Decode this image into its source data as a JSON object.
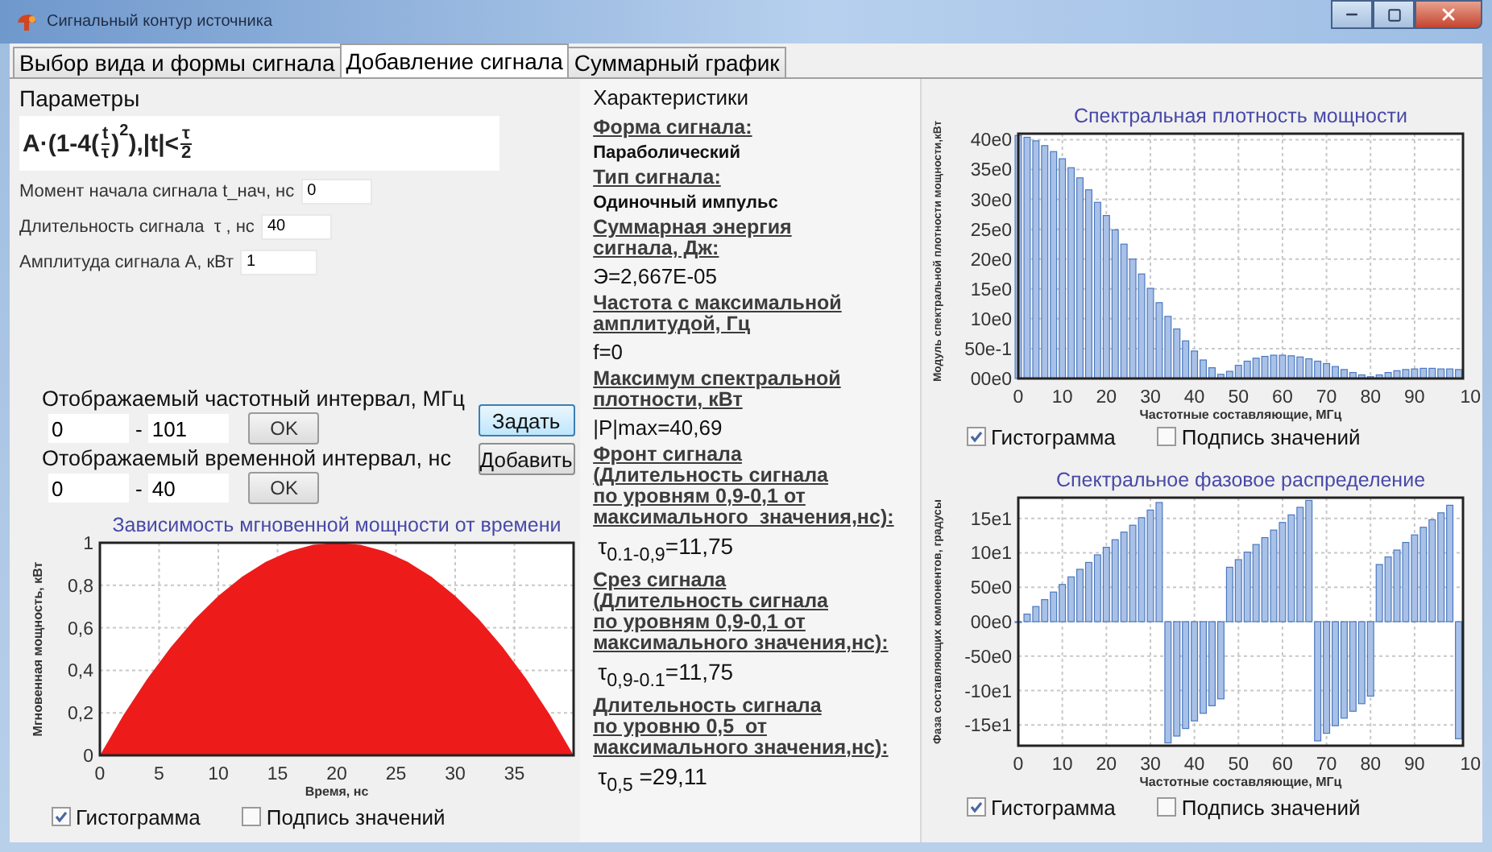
{
  "window": {
    "title": "Сигнальный контур источника"
  },
  "tabs": [
    {
      "label": "Выбор вида и формы сигнала",
      "selected": false
    },
    {
      "label": "Добавление сигнала",
      "selected": true
    },
    {
      "label": "Суммарный график",
      "selected": false
    }
  ],
  "parameters": {
    "heading": "Параметры",
    "formula": {
      "lead": "A·(1-4(",
      "frac_1": {
        "num": "t",
        "den": "τ"
      },
      "close": ")",
      "power": "2",
      "middle": "),|t|<",
      "frac_2": {
        "num": "τ",
        "den": "2"
      }
    },
    "fields": [
      {
        "label": "Момент начала сигнала t_нач, нс",
        "value": "0"
      },
      {
        "label": "Длительность сигнала  τ , нс",
        "value": "40"
      },
      {
        "label": "Амплитуда сигнала А, кВт",
        "value": "1"
      }
    ]
  },
  "intervals": [
    {
      "label": "Отображаемый частотный интервал, МГц",
      "from": "0",
      "separator": "-",
      "to": "101",
      "button": "OK"
    },
    {
      "label": "Отображаемый временной интервал, нс",
      "from": "0",
      "separator": "-",
      "to": "40",
      "button": "OK"
    }
  ],
  "actions": [
    {
      "label": "Задать",
      "focused": true
    },
    {
      "label": "Добавить",
      "focused": false
    }
  ],
  "power_chart": {
    "chart_data": {
      "type": "area",
      "title": "Зависимость мгновенной мощности от времени",
      "xlabel": "Время, нс",
      "ylabel": "Мгновенная мощность, кВт",
      "x": [
        0,
        2,
        4,
        6,
        8,
        10,
        12,
        14,
        16,
        18,
        20,
        22,
        24,
        26,
        28,
        30,
        32,
        34,
        36,
        38,
        40
      ],
      "values": [
        0,
        0.19,
        0.36,
        0.51,
        0.64,
        0.75,
        0.84,
        0.91,
        0.96,
        0.99,
        1,
        0.99,
        0.96,
        0.91,
        0.84,
        0.75,
        0.64,
        0.51,
        0.36,
        0.19,
        0
      ],
      "xlim": [
        0,
        40
      ],
      "ylim": [
        0,
        1
      ],
      "grid": true,
      "xticks": [
        0,
        5,
        10,
        15,
        20,
        25,
        30,
        35
      ],
      "yticks": [
        {
          "value": 0,
          "label": "0"
        },
        {
          "value": 0.2,
          "label": "0,2"
        },
        {
          "value": 0.4,
          "label": "0,4"
        },
        {
          "value": 0.6,
          "label": "0,6"
        },
        {
          "value": 0.8,
          "label": "0,8"
        },
        {
          "value": 1,
          "label": "1"
        }
      ]
    },
    "options": [
      {
        "label": "Гистограмма",
        "checked": true
      },
      {
        "label": "Подпись значений",
        "checked": false
      }
    ]
  },
  "characteristics": {
    "heading": "Характеристики",
    "items": [
      {
        "label": "Форма сигнала:",
        "value": "Параболический",
        "kind": "bold"
      },
      {
        "label": "Тип сигнала:",
        "value": "Одиночный импульс",
        "kind": "bold"
      },
      {
        "label": "Суммарная энергия\nсигнала, Дж:",
        "value": "Э=2,667E-05",
        "kind": "plain"
      },
      {
        "label": "Частота с максимальной\nамплитудой, Гц",
        "value": "f=0",
        "kind": "plain"
      },
      {
        "label": "Максимум спектральной\nплотности, кВт",
        "value": "|P|max=40,69",
        "kind": "plain"
      },
      {
        "label": "Фронт сигнала\n(Длительность сигнала\nпо уровням 0,9-0,1 от\nмаксимального  значения,нс):",
        "value": "τ$_{0.1-0,9}$=11,75",
        "kind": "formula"
      },
      {
        "label": "Срез сигнала\n(Длительность сигнала\nпо уровням 0,9-0,1 от\nмаксимального значения,нс):",
        "value": "τ$_{0,9-0.1}$=11,75",
        "kind": "formula"
      },
      {
        "label": "Длительность сигнала\nпо уровню 0,5  от\nмаксимального значения,нс):",
        "value": "τ$_{0,5}$ =29,11",
        "kind": "formula"
      }
    ]
  },
  "spectrum_chart": {
    "chart_data": {
      "type": "bar",
      "title": "Спектральная плотность мощности",
      "xlabel": "Частотные составляющие, МГц",
      "ylabel": "Модуль спектральной плотности мощности,кВт",
      "x": [
        0,
        2,
        4,
        6,
        8,
        10,
        12,
        14,
        16,
        18,
        20,
        22,
        24,
        26,
        28,
        30,
        32,
        34,
        36,
        38,
        40,
        42,
        44,
        46,
        48,
        50,
        52,
        54,
        56,
        58,
        60,
        62,
        64,
        66,
        68,
        70,
        72,
        74,
        76,
        78,
        80,
        82,
        84,
        86,
        88,
        90,
        92,
        94,
        96,
        98,
        100
      ],
      "values": [
        40.7,
        40.4,
        39.8,
        39,
        38,
        36.8,
        35.3,
        33.6,
        31.6,
        29.5,
        27.3,
        24.9,
        22.5,
        20,
        17.5,
        15.1,
        12.7,
        10.4,
        8.3,
        6.3,
        4.6,
        3.1,
        1.8,
        0.7,
        1.2,
        2.2,
        2.9,
        3.4,
        3.7,
        3.9,
        3.9,
        3.8,
        3.6,
        3.3,
        2.9,
        2.5,
        2,
        1.5,
        1,
        0.6,
        0.3,
        0.6,
        1,
        1.3,
        1.5,
        1.6,
        1.7,
        1.7,
        1.6,
        1.6,
        1.5
      ],
      "xlim": [
        0,
        101
      ],
      "ylim": [
        0,
        41
      ],
      "grid": true,
      "xticks": [
        0,
        10,
        20,
        30,
        40,
        50,
        60,
        70,
        80,
        90
      ],
      "yticks": [
        {
          "value": 0,
          "label": "00e0"
        },
        {
          "value": 5,
          "label": "50e-1"
        },
        {
          "value": 10,
          "label": "10e0"
        },
        {
          "value": 15,
          "label": "15e0"
        },
        {
          "value": 20,
          "label": "20e0"
        },
        {
          "value": 25,
          "label": "25e0"
        },
        {
          "value": 30,
          "label": "30e0"
        },
        {
          "value": 35,
          "label": "35e0"
        },
        {
          "value": 40,
          "label": "40e0"
        }
      ]
    },
    "edge_tick_label": "10",
    "options": [
      {
        "label": "Гистограмма",
        "checked": true
      },
      {
        "label": "Подпись значений",
        "checked": false
      }
    ]
  },
  "phase_chart": {
    "chart_data": {
      "type": "bar",
      "title": "Спектральное фазовое распределение",
      "xlabel": "Частотные составляющие, МГц",
      "ylabel": "Фаза составляющих компонентов, градусы",
      "x": [
        0,
        2,
        4,
        6,
        8,
        10,
        12,
        14,
        16,
        18,
        20,
        22,
        24,
        26,
        28,
        30,
        32,
        34,
        36,
        38,
        40,
        42,
        44,
        46,
        48,
        50,
        52,
        54,
        56,
        58,
        60,
        62,
        64,
        66,
        68,
        70,
        72,
        74,
        76,
        78,
        80,
        82,
        84,
        86,
        88,
        90,
        92,
        94,
        96,
        98,
        100
      ],
      "values": [
        0,
        11,
        22,
        32,
        43,
        54,
        65,
        76,
        86,
        97,
        108,
        119,
        130,
        140,
        151,
        162,
        173,
        -176,
        -166,
        -155,
        -144,
        -133,
        -122,
        -112,
        79,
        90,
        101,
        112,
        122,
        133,
        144,
        155,
        166,
        176,
        -173,
        -162,
        -151,
        -140,
        -130,
        -119,
        -108,
        83,
        94,
        104,
        115,
        126,
        137,
        148,
        158,
        169,
        -170
      ],
      "xlim": [
        0,
        101
      ],
      "ylim": [
        -180,
        180
      ],
      "grid": true,
      "xticks": [
        0,
        10,
        20,
        30,
        40,
        50,
        60,
        70,
        80,
        90
      ],
      "yticks": [
        {
          "value": -150,
          "label": "-15e1"
        },
        {
          "value": -100,
          "label": "-10e1"
        },
        {
          "value": -50,
          "label": "-50e0"
        },
        {
          "value": 0,
          "label": "00e0"
        },
        {
          "value": 50,
          "label": "50e0"
        },
        {
          "value": 100,
          "label": "10e1"
        },
        {
          "value": 150,
          "label": "15e1"
        }
      ]
    },
    "edge_tick_label": "10",
    "options": [
      {
        "label": "Гистограмма",
        "checked": true
      },
      {
        "label": "Подпись значений",
        "checked": false
      }
    ]
  }
}
